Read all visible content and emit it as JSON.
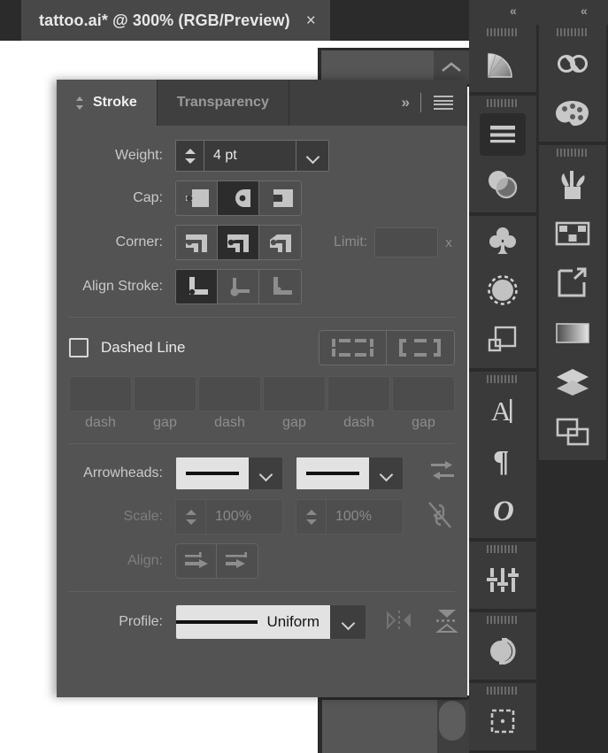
{
  "document_tab": {
    "title": "tattoo.ai* @ 300% (RGB/Preview)",
    "close_label": "×"
  },
  "panel": {
    "tabs": [
      {
        "label": "Stroke",
        "active": true
      },
      {
        "label": "Transparency",
        "active": false
      }
    ],
    "header_tools": {
      "collapse_label": "»",
      "menu_name": "panel-menu-icon"
    },
    "weight": {
      "label": "Weight:",
      "value": "4 pt"
    },
    "cap": {
      "label": "Cap:",
      "options": [
        "butt-cap",
        "round-cap",
        "projecting-cap"
      ],
      "selected_index": 1
    },
    "corner": {
      "label": "Corner:",
      "options": [
        "miter-join",
        "round-join",
        "bevel-join"
      ],
      "selected_index": 1
    },
    "limit": {
      "label": "Limit:",
      "value": "",
      "suffix": "x"
    },
    "align_stroke": {
      "label": "Align Stroke:",
      "options": [
        "align-center",
        "align-inside",
        "align-outside"
      ],
      "selected_index": 0
    },
    "dashed_line": {
      "label": "Dashed Line",
      "checked": false,
      "presets": [
        "preserve-exact-dash-lengths",
        "align-dashes-to-corners"
      ],
      "fields": [
        {
          "caption": "dash",
          "value": ""
        },
        {
          "caption": "gap",
          "value": ""
        },
        {
          "caption": "dash",
          "value": ""
        },
        {
          "caption": "gap",
          "value": ""
        },
        {
          "caption": "dash",
          "value": ""
        },
        {
          "caption": "gap",
          "value": ""
        }
      ]
    },
    "arrowheads": {
      "label": "Arrowheads:",
      "start_value": "None",
      "end_value": "None",
      "swap_label": "swap-arrowheads-icon"
    },
    "scale": {
      "label": "Scale:",
      "start_value": "100%",
      "end_value": "100%",
      "link_label": "link-scales-icon"
    },
    "align_arrowheads": {
      "label": "Align:",
      "options": [
        "extend-arrow-tip-beyond-end",
        "place-arrow-tip-at-end"
      ]
    },
    "profile": {
      "label": "Profile:",
      "value": "Uniform",
      "flip_across_label": "flip-across-icon",
      "flip_along_label": "flip-along-icon"
    }
  },
  "sidebar": {
    "collapse_left": "«",
    "collapse_right": "«",
    "left_column": [
      {
        "icon": "gradient-panel-icon",
        "selected": false,
        "grip": true
      },
      {
        "icon": "stroke-panel-icon",
        "selected": true,
        "grip": true
      },
      {
        "icon": "transparency-panel-icon",
        "selected": false,
        "grip": false
      },
      {
        "icon": "symbols-panel-icon",
        "selected": false,
        "grip": true
      },
      {
        "icon": "brushes-panel-icon",
        "selected": false,
        "grip": false
      },
      {
        "icon": "graphic-styles-panel-icon",
        "selected": false,
        "grip": false
      },
      {
        "icon": "character-panel-icon",
        "selected": false,
        "grip": true
      },
      {
        "icon": "paragraph-panel-icon",
        "selected": false,
        "grip": false
      },
      {
        "icon": "opentype-panel-icon",
        "selected": false,
        "grip": false
      },
      {
        "icon": "transform-panel-icon",
        "selected": false,
        "grip": true
      },
      {
        "icon": "pathfinder-panel-icon",
        "selected": false,
        "grip": true
      },
      {
        "icon": "artboards-panel-icon",
        "selected": false,
        "grip": true
      }
    ],
    "right_column": [
      {
        "icon": "creative-cloud-libraries-icon",
        "selected": false,
        "grip": true
      },
      {
        "icon": "color-panel-icon",
        "selected": false,
        "grip": false
      },
      {
        "icon": "brushes-jar-icon",
        "selected": false,
        "grip": true
      },
      {
        "icon": "swatches-panel-icon",
        "selected": false,
        "grip": false
      },
      {
        "icon": "export-panel-icon",
        "selected": false,
        "grip": false
      },
      {
        "icon": "gradient-swatch-icon",
        "selected": false,
        "grip": false
      },
      {
        "icon": "layers-panel-icon",
        "selected": false,
        "grip": false
      },
      {
        "icon": "appearance-panel-icon",
        "selected": false,
        "grip": false
      }
    ]
  },
  "colors": {
    "panel_bg": "#535353",
    "panel_header_bg": "#3f3f3f",
    "app_bg": "#2b2b2b",
    "selected_btn": "#2c2c2c",
    "text_primary": "#e8e8e8",
    "text_dim": "#8d8d8d",
    "field_bg": "#3a3a3a"
  }
}
